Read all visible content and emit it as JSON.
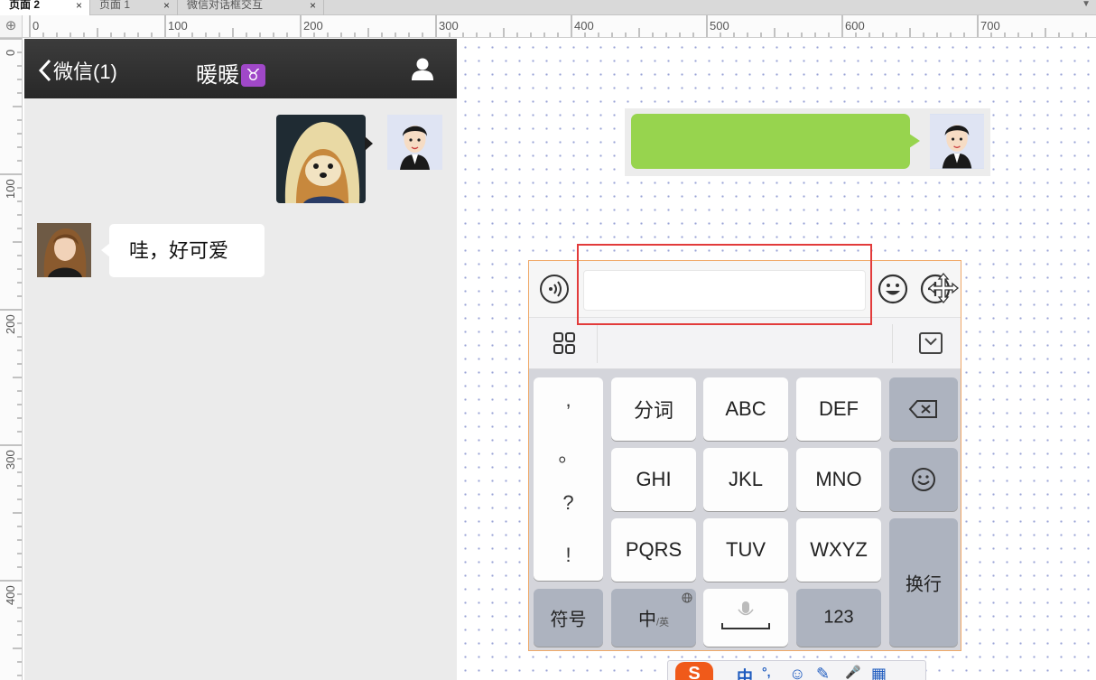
{
  "tabs": [
    {
      "label": "页面 2",
      "close": "×"
    },
    {
      "label": "页面 1",
      "close": "×"
    },
    {
      "label": "微信对话框交互",
      "close": "×"
    }
  ],
  "ruler": {
    "corner": "⊕",
    "h_labels": [
      "0",
      "100",
      "200",
      "300",
      "400",
      "500",
      "600",
      "700"
    ],
    "v_labels": [
      "0",
      "100",
      "200",
      "300",
      "400"
    ]
  },
  "chat": {
    "back_label": "微信(1)",
    "title": "暖暖",
    "title_badge": "♉",
    "received_message": "哇，好可爱"
  },
  "input_bar": {
    "voice_icon": "voice-icon",
    "emoji_icon": "emoji-icon",
    "more_icon": "more-icon"
  },
  "keyboard": {
    "punct": [
      ",",
      "。",
      "?",
      "!"
    ],
    "row1": [
      "分词",
      "ABC",
      "DEF"
    ],
    "row2": [
      "GHI",
      "JKL",
      "MNO"
    ],
    "row3": [
      "PQRS",
      "TUV",
      "WXYZ"
    ],
    "symbol_key": "符号",
    "lang_key": "中",
    "lang_key_sub": "/英",
    "num_key": "123",
    "enter_key": "换行"
  },
  "ime_toolbar": {
    "logo": "S",
    "items": [
      "中",
      "°,",
      "☺",
      "✎",
      "🎤",
      "▦"
    ]
  },
  "colors": {
    "nav_bg": "#2f2f2f",
    "chat_bg": "#ebebeb",
    "green_bubble": "#97d44e",
    "highlight_border": "#e23b3b",
    "panel_border": "#f0a867"
  }
}
